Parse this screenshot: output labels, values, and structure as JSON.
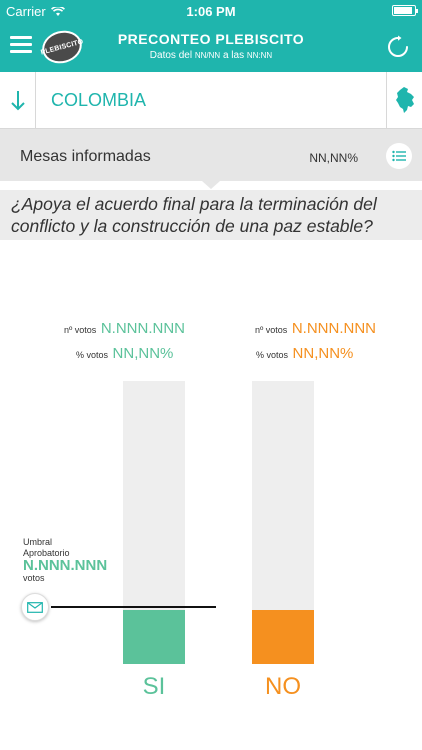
{
  "status_bar": {
    "carrier": "Carrier",
    "time": "1:06 PM",
    "battery_level": 0.9
  },
  "header": {
    "title": "PRECONTEO PLEBISCITO",
    "subtitle_prefix": "Datos del",
    "subtitle_date": "NN/NN",
    "subtitle_middle": "a las",
    "subtitle_time": "NN:NN",
    "logo_text": "PLEBISCITO"
  },
  "location": {
    "name": "COLOMBIA"
  },
  "mesas": {
    "label": "Mesas informadas",
    "value": "NN,NN%"
  },
  "question": "¿Apoya el acuerdo final para la terminación del conflicto y la construcción de una paz estable?",
  "results": {
    "votes_label": "nº votos",
    "percent_label": "% votos",
    "si": {
      "label": "SI",
      "votes": "N.NNN.NNN",
      "percent": "NN,NN%",
      "fill": 0.19
    },
    "no": {
      "label": "NO",
      "votes": "N.NNN.NNN",
      "percent": "NN,NN%",
      "fill": 0.19
    }
  },
  "threshold": {
    "label_line1": "Umbral",
    "label_line2": "Aprobatorio",
    "value": "N.NNN.NNN",
    "unit": "votos",
    "level": 0.2
  },
  "colors": {
    "primary": "#1fb5ad",
    "si": "#5bc29a",
    "no": "#f5901f",
    "bar_bg": "#eeeeee",
    "panel": "#e6e6e6"
  }
}
